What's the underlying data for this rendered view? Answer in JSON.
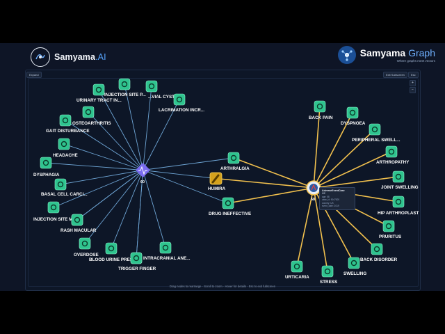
{
  "brand_left": {
    "name": "Samyama",
    "suffix": ".AI"
  },
  "brand_right": {
    "name": "Samyama",
    "suffix": "Graph",
    "tagline": "Where graphs meet vectors"
  },
  "toolbar": {
    "expand_label": "Expand",
    "exit_label": "Exit Subscreen",
    "esc_label": "Esc",
    "zoom_in": "+",
    "zoom_out": "−"
  },
  "hubs": {
    "left": {
      "count": "60",
      "color": "#7b6cf0"
    },
    "right": {
      "count": "68",
      "color": "#e8eef7"
    },
    "drug": {
      "label": "HUMIRA",
      "color": "#d4a11c"
    }
  },
  "tooltip": {
    "title": "AdverseEventCase",
    "subtitle": "ME",
    "rows": [
      "age: 58",
      "case_id: 9047820",
      "country: US",
      "event_date: 2019"
    ]
  },
  "left_nodes": [
    {
      "id": "lpos01",
      "label": "INJECTION SITE P..."
    },
    {
      "id": "lpos02",
      "label": "...VIAL CYST"
    },
    {
      "id": "lpos03",
      "label": "URINARY TRACT IN..."
    },
    {
      "id": "lpos04",
      "label": "LACRIMATION INCR..."
    },
    {
      "id": "lpos05",
      "label": "OSTEOARTHRITIS"
    },
    {
      "id": "lpos06",
      "label": "GAIT DISTURBANCE"
    },
    {
      "id": "lpos07",
      "label": "HEADACHE"
    },
    {
      "id": "lpos08",
      "label": "DYSPHAGIA"
    },
    {
      "id": "lpos09",
      "label": "BASAL CELL CARCI..."
    },
    {
      "id": "lpos10",
      "label": "INJECTION SITE M..."
    },
    {
      "id": "lpos11",
      "label": "RASH MACULAR"
    },
    {
      "id": "lpos12",
      "label": "OVERDOSE"
    },
    {
      "id": "lpos13",
      "label": "BLOOD URINE PRES..."
    },
    {
      "id": "lpos14",
      "label": "TRIGGER FINGER"
    },
    {
      "id": "lpos15",
      "label": "INTRACRANIAL ANE..."
    },
    {
      "id": "lpos16",
      "label": ""
    },
    {
      "id": "lpos17",
      "label": ""
    }
  ],
  "middle_nodes": [
    {
      "id": "mpos1",
      "label": "ARTHRALGIA"
    },
    {
      "id": "mpos2",
      "label": "DRUG INEFFECTIVE"
    }
  ],
  "right_nodes": [
    {
      "id": "rpos01",
      "label": "BACK PAIN"
    },
    {
      "id": "rpos02",
      "label": "DYSPNOEA"
    },
    {
      "id": "rpos03",
      "label": "PERIPHERAL SWELL..."
    },
    {
      "id": "rpos04",
      "label": "ARTHROPATHY"
    },
    {
      "id": "rpos05",
      "label": "JOINT SWELLING"
    },
    {
      "id": "rpos06",
      "label": "HIP ARTHROPLAST"
    },
    {
      "id": "rpos07",
      "label": "PRURITUS"
    },
    {
      "id": "rpos08",
      "label": "BACK DISORDER"
    },
    {
      "id": "rpos09",
      "label": "SWELLING"
    },
    {
      "id": "rpos10",
      "label": "STRESS"
    },
    {
      "id": "rpos11",
      "label": "URTICARIA"
    }
  ],
  "hint_text": "Drag nodes to rearrange · Scroll to zoom · Hover for details · Esc to exit fullscreen",
  "colors": {
    "node_fill": "#2fc48f",
    "left_edge": "#6fa6d6",
    "right_edge": "#f2c14e",
    "background": "#0d1627"
  }
}
